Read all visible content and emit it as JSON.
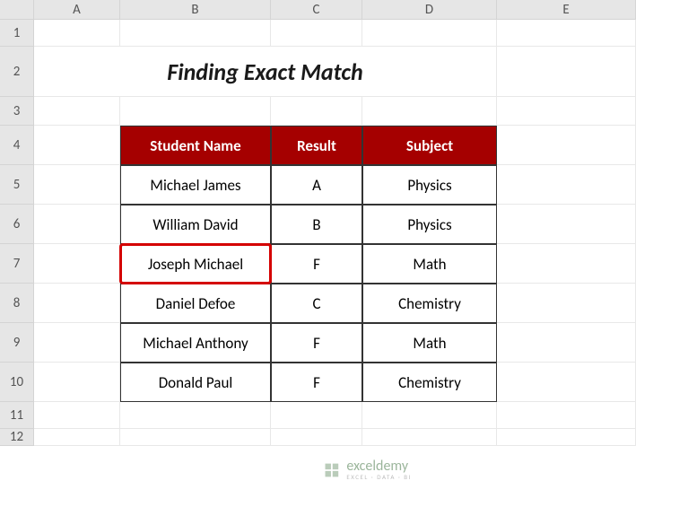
{
  "columns": [
    "A",
    "B",
    "C",
    "D",
    "E"
  ],
  "rows": [
    "1",
    "2",
    "3",
    "4",
    "5",
    "6",
    "7",
    "8",
    "9",
    "10",
    "11",
    "12"
  ],
  "title": "Finding Exact Match",
  "table": {
    "headers": [
      "Student Name",
      "Result",
      "Subject"
    ],
    "data": [
      {
        "name": "Michael James",
        "result": "A",
        "subject": "Physics"
      },
      {
        "name": "William David",
        "result": "B",
        "subject": "Physics"
      },
      {
        "name": "Joseph Michael",
        "result": "F",
        "subject": "Math"
      },
      {
        "name": "Daniel Defoe",
        "result": "C",
        "subject": "Chemistry"
      },
      {
        "name": "Michael Anthony",
        "result": "F",
        "subject": "Math"
      },
      {
        "name": "Donald Paul",
        "result": "F",
        "subject": "Chemistry"
      }
    ],
    "highlighted_cell": {
      "row": 2,
      "col": "name"
    }
  },
  "watermark": {
    "brand": "exceldemy",
    "sub": "EXCEL · DATA · BI"
  }
}
